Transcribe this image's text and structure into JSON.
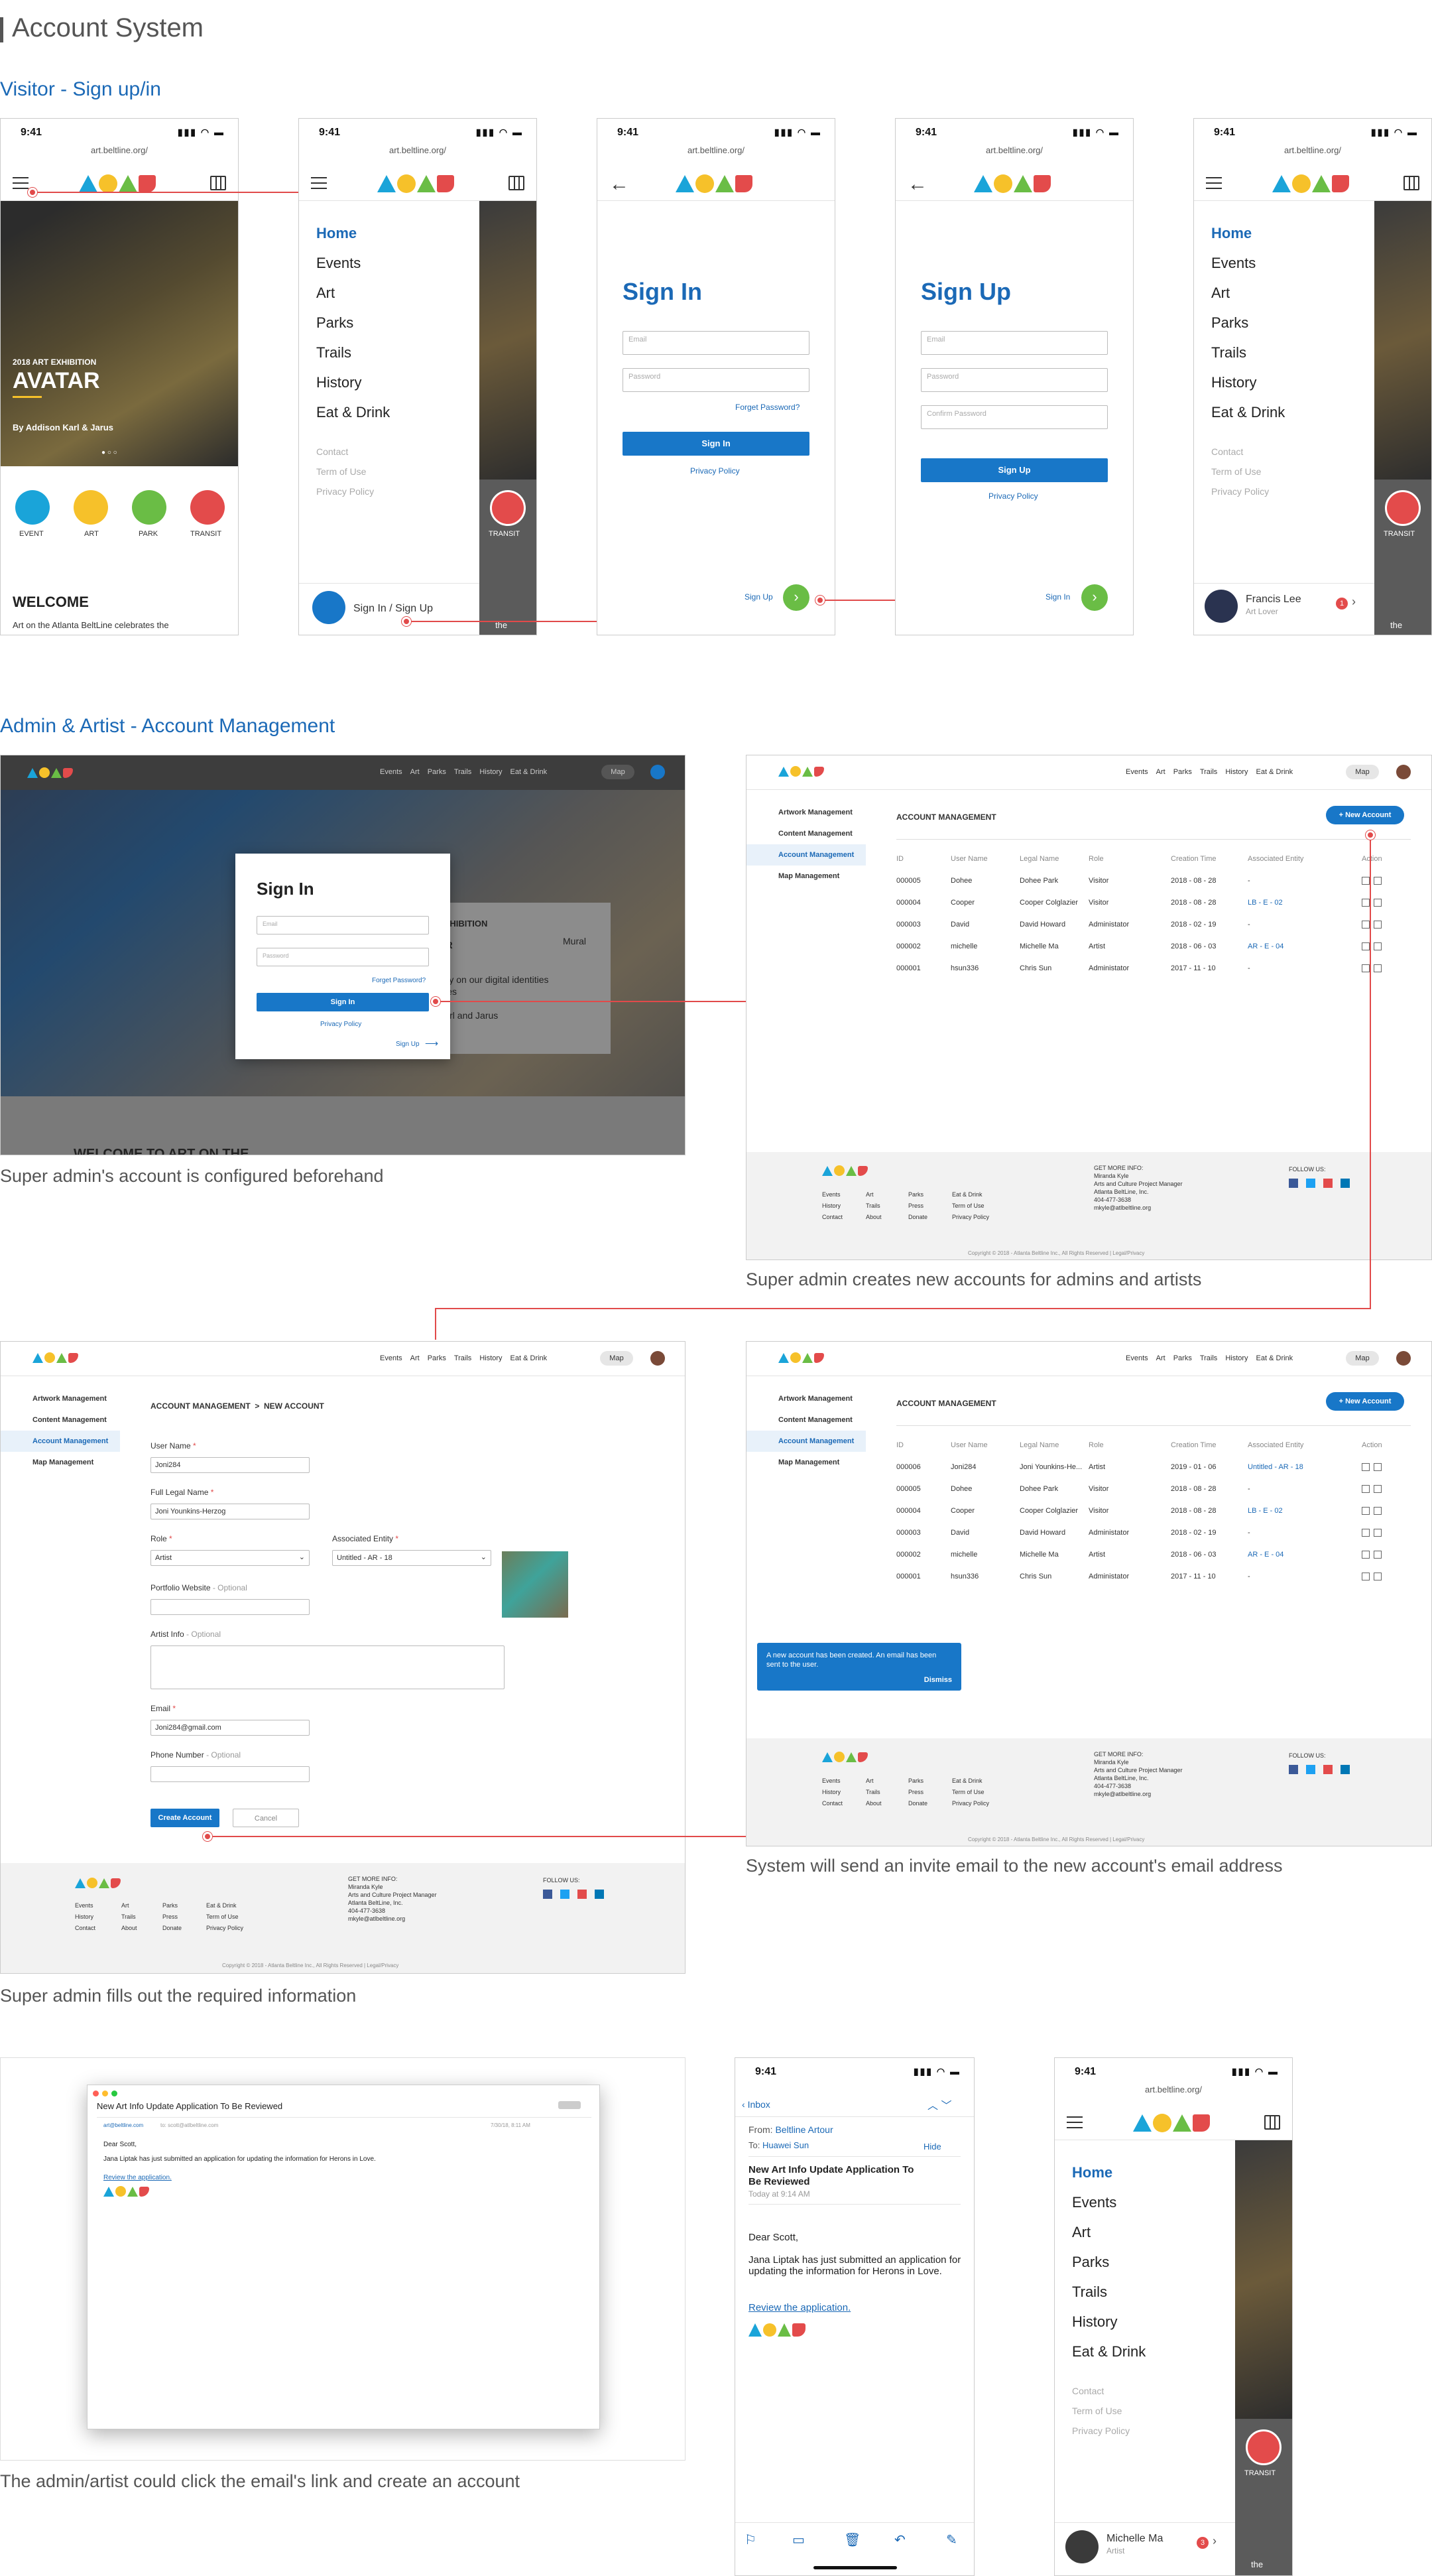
{
  "page": {
    "title": "Account System"
  },
  "sections": {
    "visitor": "Visitor - Sign up/in",
    "admin": "Admin & Artist - Account Management"
  },
  "phone": {
    "time": "9:41",
    "url": "art.beltline.org/",
    "signal": "▮▮▮ ◠ ▬"
  },
  "home": {
    "kicker": "2018 ART EXHIBITION",
    "title": "AVATAR",
    "byline": "By Addison Karl & Jarus",
    "dots": "● ○ ○",
    "cats": [
      "EVENT",
      "ART",
      "PARK",
      "TRANSIT"
    ],
    "welcome": "WELCOME",
    "intro": "Art on the Atlanta BeltLine celebrates the"
  },
  "menu": {
    "items": [
      "Home",
      "Events",
      "Art",
      "Parks",
      "Trails",
      "History",
      "Eat & Drink"
    ],
    "sub": [
      "Contact",
      "Term of Use",
      "Privacy Policy"
    ],
    "signin": "Sign In / Sign Up",
    "transit": "TRANSIT",
    "behind": "the"
  },
  "signin": {
    "title": "Sign In",
    "email": "Email",
    "password": "Password",
    "forget": "Forget Password?",
    "button": "Sign In",
    "privacy": "Privacy Policy",
    "footer_link": "Sign Up"
  },
  "signup": {
    "title": "Sign Up",
    "email": "Email",
    "password": "Password",
    "confirm": "Confirm Password",
    "button": "Sign Up",
    "privacy": "Privacy Policy",
    "footer_link": "Sign In"
  },
  "user1": {
    "name": "Francis Lee",
    "role": "Art Lover",
    "badge": "1"
  },
  "user2": {
    "name": "Michelle Ma",
    "role": "Artist",
    "badge": "3"
  },
  "web": {
    "nav": [
      "Events",
      "Art",
      "Parks",
      "Trails",
      "History",
      "Eat & Drink"
    ],
    "map": "Map",
    "exhibit": "EXHIBITION",
    "ar": "AR",
    "mural": "Mural",
    "body1": "tary on our digital identities",
    "body2": "lities",
    "artists": "Karl and Jarus",
    "welcome": "WELCOME TO ART ON THE"
  },
  "side": {
    "items": [
      "Artwork Management",
      "Content Management",
      "Account Management",
      "Map Management"
    ]
  },
  "mgmt": {
    "title": "ACCOUNT MANAGEMENT",
    "new_button": "+ New Account",
    "cols": [
      "ID",
      "User Name",
      "Legal Name",
      "Role",
      "Creation Time",
      "Associated Entity",
      "Action"
    ],
    "rows": [
      [
        "000005",
        "Dohee",
        "Dohee Park",
        "Visitor",
        "2018 - 08 - 28",
        "-"
      ],
      [
        "000004",
        "Cooper",
        "Cooper Colglazier",
        "Visitor",
        "2018 - 08 - 28",
        "LB - E - 02"
      ],
      [
        "000003",
        "David",
        "David Howard",
        "Administator",
        "2018 - 02 - 19",
        "-"
      ],
      [
        "000002",
        "michelle",
        "Michelle Ma",
        "Artist",
        "2018 - 06 - 03",
        "AR - E - 04"
      ],
      [
        "000001",
        "hsun336",
        "Chris Sun",
        "Administator",
        "2017 - 11 - 10",
        "-"
      ]
    ],
    "rows2": [
      [
        "000006",
        "Joni284",
        "Joni Younkins-He...",
        "Artist",
        "2019 - 01 - 06",
        "Untitled - AR - 18"
      ],
      [
        "000005",
        "Dohee",
        "Dohee Park",
        "Visitor",
        "2018 - 08 - 28",
        "-"
      ],
      [
        "000004",
        "Cooper",
        "Cooper Colglazier",
        "Visitor",
        "2018 - 08 - 28",
        "LB - E - 02"
      ],
      [
        "000003",
        "David",
        "David Howard",
        "Administator",
        "2018 - 02 - 19",
        "-"
      ],
      [
        "000002",
        "michelle",
        "Michelle Ma",
        "Artist",
        "2018 - 06 - 03",
        "AR - E - 04"
      ],
      [
        "000001",
        "hsun336",
        "Chris Sun",
        "Administator",
        "2017 - 11 - 10",
        "-"
      ]
    ],
    "toast": "A new account has been created. An email has been sent to the user.",
    "dismiss": "Dismiss"
  },
  "form": {
    "crumb": "ACCOUNT MANAGEMENT  >  NEW ACCOUNT",
    "user_lbl": "User Name",
    "user_val": "Joni284",
    "legal_lbl": "Full Legal Name",
    "legal_val": "Joni Younkins-Herzog",
    "role_lbl": "Role",
    "role_val": "Artist",
    "entity_lbl": "Associated Entity",
    "entity_val": "Untitled - AR - 18",
    "portfolio_lbl": "Portfolio Website",
    "info_lbl": "Artist Info",
    "optional": "- Optional",
    "email_lbl": "Email",
    "email_val": "Joni284@gmail.com",
    "phone_lbl": "Phone Number",
    "create": "Create Account",
    "cancel": "Cancel",
    "star": "*"
  },
  "footer": {
    "col1": [
      "Events",
      "History",
      "Contact"
    ],
    "col2": [
      "Art",
      "Trails",
      "About"
    ],
    "col3": [
      "Parks",
      "Press",
      "Donate"
    ],
    "col4": [
      "Eat & Drink",
      "Term of Use",
      "Privacy Policy"
    ],
    "info_head": "GET MORE INFO:",
    "info": [
      "Miranda Kyle",
      "Arts and Culture Project Manager",
      "Atlanta BeltLine, Inc.",
      "404-477-3638",
      "mkyle@atlbeltline.org"
    ],
    "follow": "FOLLOW US:",
    "copyright": "Copyright © 2018 - Atlanta Beltline Inc., All Rights Reserved | Legal/Privacy"
  },
  "captions": {
    "c1": "Super admin's account is configured beforehand",
    "c2": "Super admin creates new accounts for admins and artists",
    "c3": "Super admin fills out the required information",
    "c4": "System will send an invite email to the new account's email address",
    "c5": "The admin/artist could click the email's link and create an account"
  },
  "email": {
    "subject": "New Art Info Update Application To Be Reviewed",
    "from_line": "art@beltline.com",
    "to_line": "to: scott@atlbeltline.com",
    "date": "7/30/18, 8:11 AM",
    "greeting": "Dear Scott,",
    "body": "Jana Liptak has just submitted an application for updating the information for Herons in Love.",
    "link": "Review the application."
  },
  "mail": {
    "inbox": "Inbox",
    "from_lbl": "From:",
    "from": "Beltline Artour",
    "to_lbl": "To:",
    "to": "Huawei Sun",
    "hide": "Hide",
    "subject": "New Art Info Update Application To Be Reviewed",
    "time": "Today at 9:14 AM",
    "greeting": "Dear Scott,",
    "body": "Jana Liptak has just submitted an application for updating the information for Herons in Love.",
    "link": "Review the application."
  }
}
